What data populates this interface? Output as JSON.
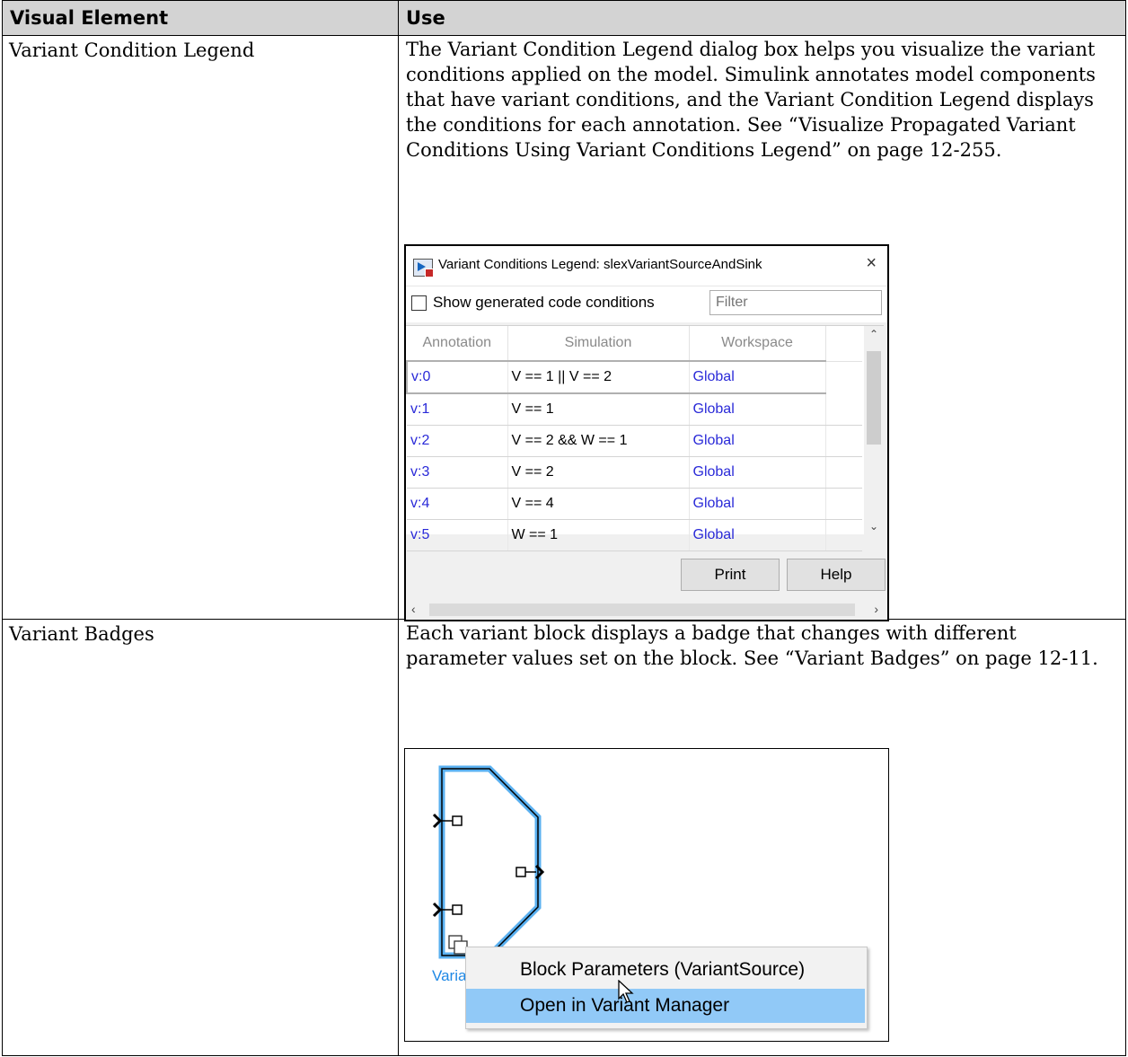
{
  "table": {
    "headers": [
      "Visual Element",
      "Use"
    ],
    "rows": [
      {
        "element": "Variant Condition Legend",
        "use": "The Variant Condition Legend dialog box helps you visualize the variant conditions applied on the model. Simulink annotates model components that have variant conditions, and the Variant Condition Legend displays the conditions for each annotation. See “Visualize Propagated Variant Conditions Using Variant Conditions Legend” on page 12-255."
      },
      {
        "element": "Variant Badges",
        "use": "Each variant block displays a badge that changes with different parameter values set on the block. See “Variant Badges” on page 12-11."
      }
    ]
  },
  "legend_dialog": {
    "title": "Variant Conditions Legend: slexVariantSourceAndSink",
    "close_symbol": "×",
    "checkbox_label": "Show generated code conditions",
    "checkbox_checked": false,
    "filter_placeholder": "Filter",
    "columns": [
      "Annotation",
      "Simulation",
      "Workspace"
    ],
    "rows": [
      {
        "annotation": "v:0",
        "simulation": "V == 1 || V == 2",
        "workspace": "Global"
      },
      {
        "annotation": "v:1",
        "simulation": "V == 1",
        "workspace": "Global"
      },
      {
        "annotation": "v:2",
        "simulation": "V == 2 && W == 1",
        "workspace": "Global"
      },
      {
        "annotation": "v:3",
        "simulation": "V == 2",
        "workspace": "Global"
      },
      {
        "annotation": "v:4",
        "simulation": "V == 4",
        "workspace": "Global"
      },
      {
        "annotation": "v:5",
        "simulation": "W == 1",
        "workspace": "Global"
      }
    ],
    "print_label": "Print",
    "help_label": "Help",
    "link_color": "#2a2ad8"
  },
  "badge_panel": {
    "block_label": "Varia",
    "block_color": "#5ab0f0",
    "menu_items": [
      "Block Parameters (VariantSource)",
      "Open in Variant Manager"
    ],
    "highlight_color": "#91c9f7"
  }
}
